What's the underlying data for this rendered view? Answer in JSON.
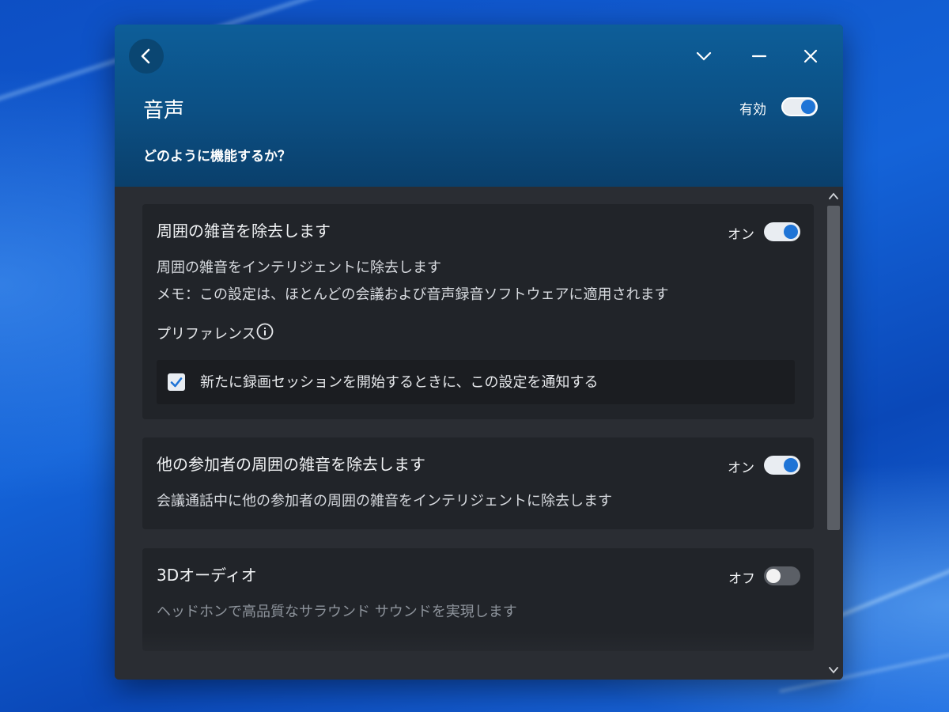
{
  "window": {
    "title": "音声",
    "subtitle": "どのように機能するか？",
    "master_toggle": {
      "label": "有効",
      "state": "on"
    }
  },
  "cards": [
    {
      "title": "周囲の雑音を除去します",
      "state_label": "オン",
      "state": "on",
      "description": "周囲の雑音をインテリジェントに除去します",
      "note": "メモ：この設定は、ほとんどの会議および音声録音ソフトウェアに適用されます",
      "preference_label": "プリファレンス",
      "checkbox": {
        "label": "新たに録画セッションを開始するときに、この設定を通知する",
        "checked": true
      }
    },
    {
      "title": "他の参加者の周囲の雑音を除去します",
      "state_label": "オン",
      "state": "on",
      "description": "会議通話中に他の参加者の周囲の雑音をインテリジェントに除去します"
    },
    {
      "title": "3Dオーディオ",
      "state_label": "オフ",
      "state": "off",
      "description": "ヘッドホンで高品質なサラウンド サウンドを実現します"
    }
  ],
  "colors": {
    "accent": "#1f74d6",
    "header": "#0c4f83",
    "card_bg": "#212429",
    "panel_bg": "#2a2d33"
  }
}
